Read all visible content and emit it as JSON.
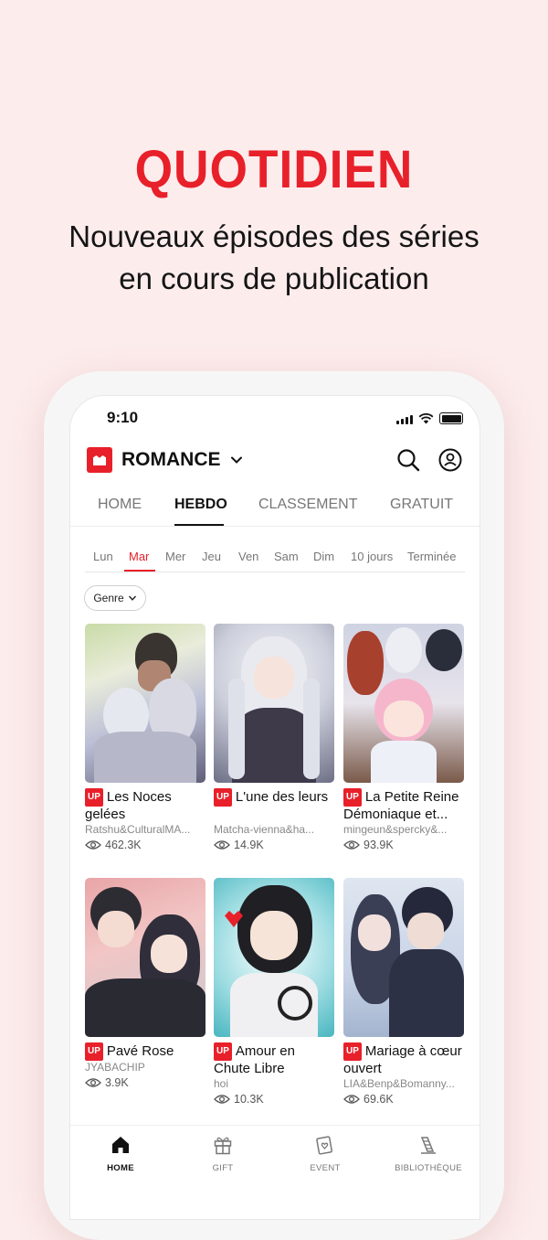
{
  "promo": {
    "headline": "QUOTIDIEN",
    "subline1": "Nouveaux épisodes des séries",
    "subline2": "en cours de publication"
  },
  "status_bar": {
    "time": "9:10"
  },
  "appbar": {
    "title": "ROMANCE"
  },
  "tabs": [
    {
      "label": "HOME",
      "active": false
    },
    {
      "label": "HEBDO",
      "active": true
    },
    {
      "label": "CLASSEMENT",
      "active": false
    },
    {
      "label": "GRATUIT",
      "active": false
    }
  ],
  "days": [
    {
      "label": "Lun"
    },
    {
      "label": "Mar",
      "active": true
    },
    {
      "label": "Mer"
    },
    {
      "label": "Jeu"
    },
    {
      "label": "Ven"
    },
    {
      "label": "Sam"
    },
    {
      "label": "Dim"
    },
    {
      "label": "10 jours"
    },
    {
      "label": "Terminée"
    }
  ],
  "filter": {
    "genre_label": "Genre"
  },
  "badge_up": "UP",
  "cards": [
    {
      "title": "Les Noces gelées",
      "author": "Ratshu&CulturalMA...",
      "views": "462.3K"
    },
    {
      "title": "L'une des leurs",
      "author": "Matcha-vienna&ha...",
      "views": "14.9K"
    },
    {
      "title": "La Petite Reine Démoniaque et...",
      "author": "mingeun&spercky&...",
      "views": "93.9K"
    },
    {
      "title": "Pavé Rose",
      "author": "JYABACHIP",
      "views": "3.9K"
    },
    {
      "title": "Amour en Chute Libre",
      "author": "hoi",
      "views": "10.3K"
    },
    {
      "title": "Mariage à cœur ouvert",
      "author": "LIA&Benp&Bomanny...",
      "views": "69.6K"
    }
  ],
  "bottom_nav": [
    {
      "label": "HOME",
      "icon": "home-icon",
      "active": true
    },
    {
      "label": "GIFT",
      "icon": "gift-icon"
    },
    {
      "label": "EVENT",
      "icon": "event-icon"
    },
    {
      "label": "BIBLIOTHÈQUE",
      "icon": "library-icon"
    }
  ],
  "colors": {
    "accent": "#e8202a",
    "background": "#fdecec"
  }
}
